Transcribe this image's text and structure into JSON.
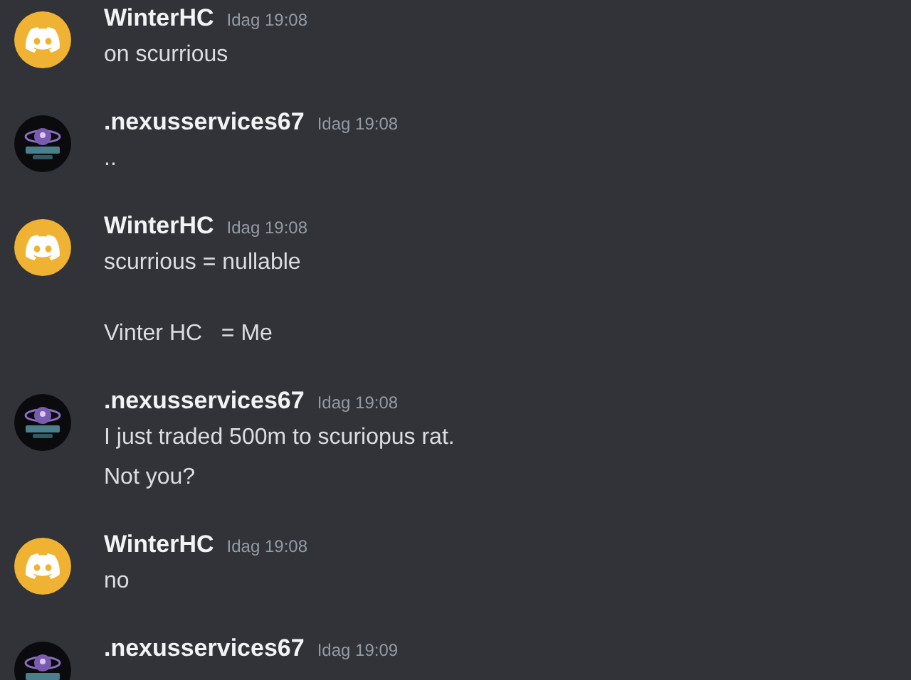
{
  "messages": [
    {
      "author": "WinterHC",
      "kind": "discord",
      "timestamp": "Idag 19:08",
      "lines": [
        "on scurrious"
      ]
    },
    {
      "author": ".nexusservices67",
      "kind": "badge",
      "timestamp": "Idag 19:08",
      "lines": [
        ".."
      ]
    },
    {
      "author": "WinterHC",
      "kind": "discord",
      "timestamp": "Idag 19:08",
      "lines": [
        "scurrious = nullable\n\nVinter HC   = Me"
      ]
    },
    {
      "author": ".nexusservices67",
      "kind": "badge",
      "timestamp": "Idag 19:08",
      "lines": [
        "I just traded 500m to scuriopus rat.",
        "Not you?"
      ]
    },
    {
      "author": "WinterHC",
      "kind": "discord",
      "timestamp": "Idag 19:08",
      "lines": [
        "no"
      ]
    },
    {
      "author": ".nexusservices67",
      "kind": "badge",
      "timestamp": "Idag 19:09"
    }
  ]
}
